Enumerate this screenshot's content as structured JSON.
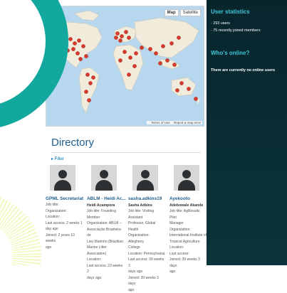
{
  "map": {
    "map_btn": "Map",
    "satellite_btn": "Satellite",
    "terms": "Terms of Use",
    "report": "Report a map error"
  },
  "directory": {
    "title": "Directory",
    "filter": "▸ Filter",
    "members": [
      {
        "name": "GPML Secretariat",
        "sub": "",
        "details": "Job title:\nOrganization:\nLocation:\nLast access: 2 weeks 1 day ago\nJoined: 2 years 10 weeks ago"
      },
      {
        "name": "ABLM - Heidi Ac...",
        "sub": "Heidi Acampora",
        "details": "Job title: Founding Member\nOrganization: ABLM – Associação Brasileira do Lixo Marinho (Brazilian Marine Litter Association)\nLocation:\nLast access: 23 weeks 2 days ago"
      },
      {
        "name": "sasha.adkins19",
        "sub": "Sasha Adkins",
        "details": "Job title: Visiting Assistant Professor, Global Health\nOrganization: Allegheny College\nLocation: Pennsylvania\nLast access: 39 weeks 3 days ago\nJoined: 39 weeks 3 days ago"
      },
      {
        "name": "Ayekooto",
        "sub": "Adebowale Akande",
        "details": "Job title: AgResults Pilot Manager\nOrganization: International Institute of Tropical Agriculture\nLocation:\nLast access:\nJoined: 39 weeks 3 days ago"
      }
    ]
  },
  "sidebar": {
    "stats_title": "User statistics",
    "users": "· 293 users",
    "recent": "· 75 recently joined members",
    "online_title": "Who's online?",
    "online_text": "There are currently no online users"
  },
  "colors": {
    "accent": "#2ec4d3",
    "sidebar_bg": "#0b2f36",
    "link": "#1f5e8e"
  }
}
